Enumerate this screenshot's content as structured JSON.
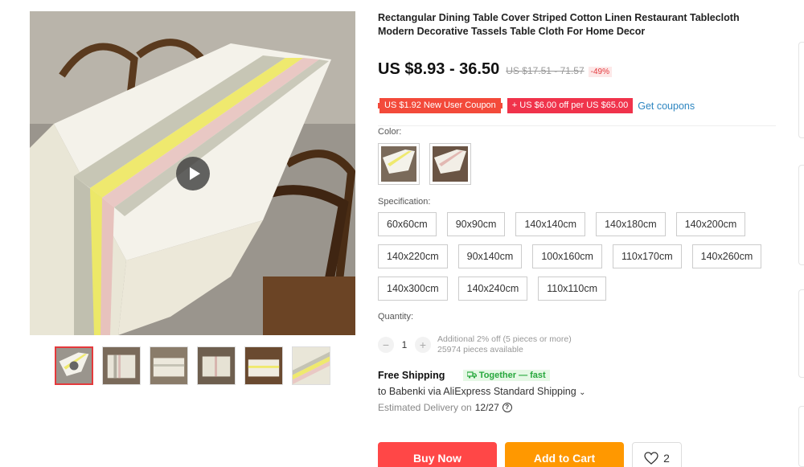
{
  "product": {
    "title": "Rectangular Dining Table Cover Striped Cotton Linen Restaurant Tablecloth Modern Decorative Tassels Table Cloth For Home Decor",
    "price": "US $8.93 - 36.50",
    "old_price": "US $17.51 - 71.57",
    "discount": "-49%"
  },
  "coupons": {
    "new_user": "US $1.92 New User Coupon",
    "off": "+ US $6.00 off per US $65.00",
    "get": "Get coupons"
  },
  "color": {
    "label": "Color:",
    "options": [
      "yellow-pink-stripe",
      "pink-stripe"
    ]
  },
  "specification": {
    "label": "Specification:",
    "rows": [
      [
        "60x60cm",
        "90x90cm",
        "140x140cm",
        "140x180cm",
        "140x200cm"
      ],
      [
        "140x220cm",
        "90x140cm",
        "100x160cm",
        "110x170cm",
        "140x260cm"
      ],
      [
        "140x300cm",
        "140x240cm",
        "110x110cm"
      ]
    ]
  },
  "quantity": {
    "label": "Quantity:",
    "minus": "−",
    "value": "1",
    "plus": "+",
    "note1": "Additional 2% off (5 pieces or more)",
    "note2": "25974 pieces available"
  },
  "shipping": {
    "title": "Free Shipping",
    "badge": "Together — fast",
    "line": "to Babenki via AliExpress Standard Shipping",
    "chevron": "⌄",
    "delivery_prefix": "Estimated Delivery on",
    "delivery_date": "12/27",
    "help": "?"
  },
  "actions": {
    "buy": "Buy Now",
    "cart": "Add to Cart",
    "wish_count": "2"
  },
  "icons": {
    "play": "play-icon",
    "heart": "heart-icon",
    "truck": "truck-icon",
    "help": "question-icon"
  },
  "colors": {
    "buy": "#ff4747",
    "cart": "#ff9800",
    "coupon_red": "#f34a3a",
    "link": "#2e86c1",
    "together_green": "#27a83d"
  }
}
